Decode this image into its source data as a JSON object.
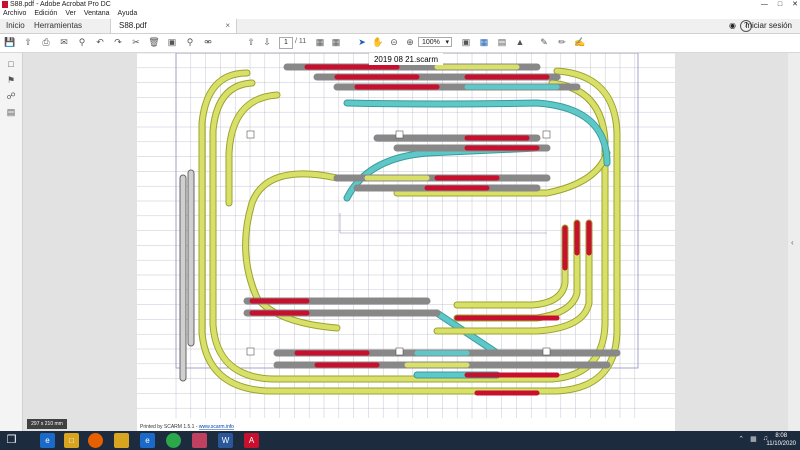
{
  "window": {
    "title": "S88.pdf - Adobe Acrobat Pro DC",
    "controls": [
      "—",
      "□",
      "✕"
    ]
  },
  "menu": [
    "Archivo",
    "Edición",
    "Ver",
    "Ventana",
    "Ayuda"
  ],
  "tabs": {
    "home": "Inicio",
    "tools": "Herramientas",
    "document": "S88.pdf",
    "close": "×",
    "signin": "Iniciar sesión",
    "help": "?"
  },
  "toolbar": {
    "page_current": "1",
    "page_total": "/ 11",
    "zoom": "100%",
    "icons": [
      "save-icon",
      "upload-icon",
      "print-icon",
      "email-icon",
      "search-doc-icon",
      "undo-icon",
      "redo-icon",
      "cut-icon",
      "delete-icon",
      "camera-icon",
      "search-icon",
      "binoculars-icon",
      "prev-page-icon",
      "next-page-icon",
      "fit-page-icon",
      "select-icon",
      "hand-icon",
      "zoom-out-icon",
      "zoom-in-icon",
      "zoom-dropdown-icon",
      "fit-icon",
      "scroll-icon",
      "read-mode-icon",
      "stamp-icon",
      "comment-icon",
      "highlight-icon",
      "sign-icon"
    ]
  },
  "left_panel": [
    "pages-icon",
    "bookmarks-icon",
    "attachment-icon",
    "layers-icon"
  ],
  "document": {
    "layout_title": "2019 08 21.scarm",
    "footer_prefix": "Printed by SCARM 1.5.1 - ",
    "footer_link": "www.scarm.info",
    "page_size": "297 x 210 mm"
  },
  "colors": {
    "track_yellow": "#d9e06a",
    "track_red": "#c8102e",
    "track_cyan": "#5ec8c8",
    "track_gray": "#777777",
    "grid": "#b8b8c8"
  },
  "taskbar": {
    "apps": [
      "start-icon",
      "ie-icon",
      "explorer-icon",
      "firefox-icon",
      "chrome-folder-icon",
      "edge-icon",
      "chrome-icon",
      "paint-icon",
      "word-icon",
      "acrobat-icon"
    ],
    "time": "8:08",
    "date": "11/10/2020"
  }
}
